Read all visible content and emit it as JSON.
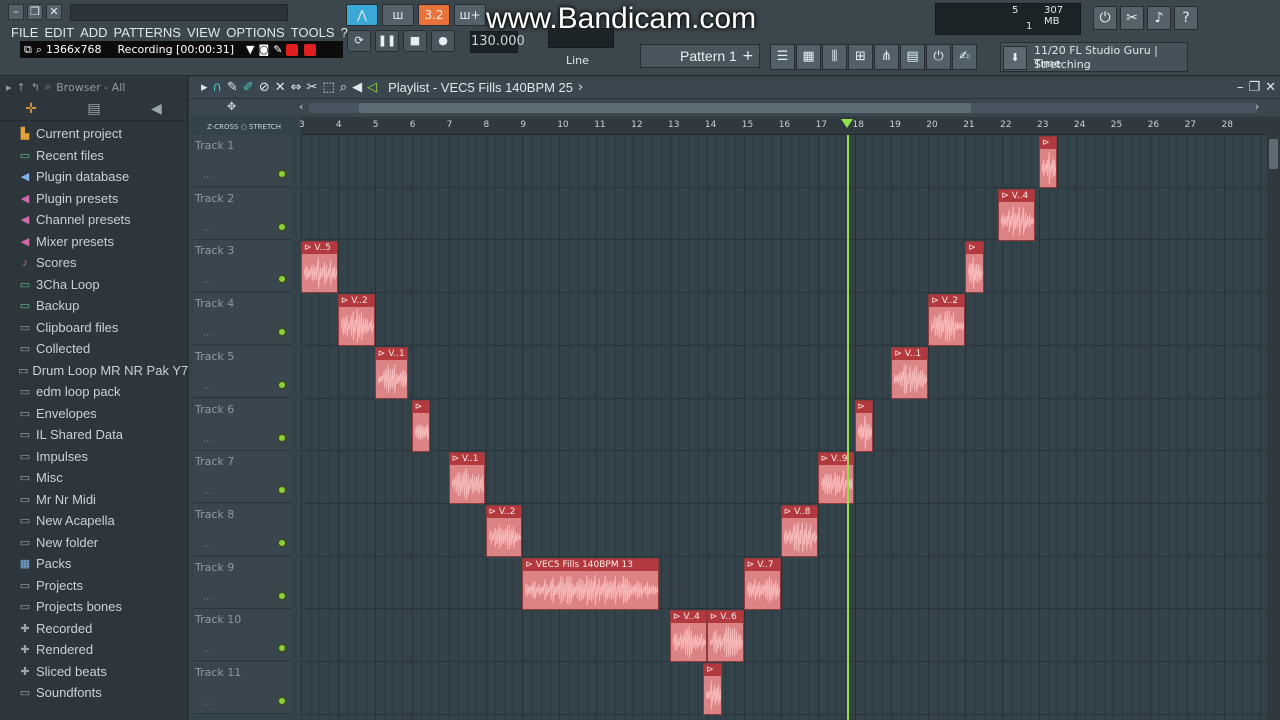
{
  "topbar": {
    "menu": [
      "FILE",
      "EDIT",
      "ADD",
      "PATTERNS",
      "VIEW",
      "OPTIONS",
      "TOOLS",
      "?"
    ],
    "recorder": {
      "resolution": "1366x768",
      "status": "Recording [00:00:31]"
    },
    "watermark": "www.Bandicam.com",
    "tempo": "130.000",
    "snap": "Line",
    "pattern": "Pattern 1",
    "memory": {
      "value_a": "5",
      "value_b": "307 MB",
      "value_c": "1"
    },
    "hint": {
      "line1": "11/20  FL Studio Guru | Time",
      "line2": "Stretching"
    }
  },
  "browser": {
    "header": "Browser - All",
    "items": [
      {
        "label": "Current project",
        "icon": "project-icon",
        "color": "#e2a43a"
      },
      {
        "label": "Recent files",
        "icon": "folder-icon",
        "color": "#5fc08a"
      },
      {
        "label": "Plugin database",
        "icon": "plugin-icon",
        "color": "#7fb0e6"
      },
      {
        "label": "Plugin presets",
        "icon": "preset-icon",
        "color": "#d16ba8"
      },
      {
        "label": "Channel presets",
        "icon": "preset-icon",
        "color": "#d16ba8"
      },
      {
        "label": "Mixer presets",
        "icon": "preset-icon",
        "color": "#d16ba8"
      },
      {
        "label": "Scores",
        "icon": "note-icon",
        "color": "#d16ba8"
      },
      {
        "label": "3Cha Loop",
        "icon": "folder-icon",
        "color": "#5fc08a"
      },
      {
        "label": "Backup",
        "icon": "folder-icon",
        "color": "#5fc08a"
      },
      {
        "label": "Clipboard files",
        "icon": "folder-icon",
        "color": "#9aa6ad"
      },
      {
        "label": "Collected",
        "icon": "folder-icon",
        "color": "#9aa6ad"
      },
      {
        "label": "Drum Loop MR NR Pak Y7",
        "icon": "folder-icon",
        "color": "#9aa6ad"
      },
      {
        "label": "edm loop pack",
        "icon": "folder-icon",
        "color": "#9aa6ad"
      },
      {
        "label": "Envelopes",
        "icon": "folder-icon",
        "color": "#9aa6ad"
      },
      {
        "label": "IL Shared Data",
        "icon": "folder-icon",
        "color": "#9aa6ad"
      },
      {
        "label": "Impulses",
        "icon": "folder-icon",
        "color": "#9aa6ad"
      },
      {
        "label": "Misc",
        "icon": "folder-icon",
        "color": "#9aa6ad"
      },
      {
        "label": "Mr Nr Midi",
        "icon": "folder-icon",
        "color": "#9aa6ad"
      },
      {
        "label": "New Acapella",
        "icon": "folder-icon",
        "color": "#9aa6ad"
      },
      {
        "label": "New folder",
        "icon": "folder-icon",
        "color": "#9aa6ad"
      },
      {
        "label": "Packs",
        "icon": "pack-icon",
        "color": "#7fb0e6"
      },
      {
        "label": "Projects",
        "icon": "folder-icon",
        "color": "#9aa6ad"
      },
      {
        "label": "Projects bones",
        "icon": "folder-icon",
        "color": "#9aa6ad"
      },
      {
        "label": "Recorded",
        "icon": "plus-icon",
        "color": "#9aa6ad"
      },
      {
        "label": "Rendered",
        "icon": "plus-icon",
        "color": "#9aa6ad"
      },
      {
        "label": "Sliced beats",
        "icon": "plus-icon",
        "color": "#9aa6ad"
      },
      {
        "label": "Soundfonts",
        "icon": "folder-icon",
        "color": "#9aa6ad"
      }
    ]
  },
  "playlist": {
    "title": "Playlist - VEC5 Fills 140BPM 25",
    "zcross": "Z-CROSS",
    "stretch": "STRETCH",
    "ruler_labels": [
      "3",
      "4",
      "5",
      "6",
      "7",
      "8",
      "9",
      "10",
      "11",
      "12",
      "13",
      "14",
      "15",
      "16",
      "17",
      "18",
      "19",
      "20",
      "21",
      "22",
      "23",
      "24",
      "25",
      "26",
      "27",
      "28"
    ],
    "tracks": [
      "Track 1",
      "Track 2",
      "Track 3",
      "Track 4",
      "Track 5",
      "Track 6",
      "Track 7",
      "Track 8",
      "Track 9",
      "Track 10",
      "Track 11"
    ],
    "playhead_bar": 17.8,
    "clips": [
      {
        "track": 0,
        "start": 23.0,
        "len": 0.5,
        "label": ""
      },
      {
        "track": 1,
        "start": 21.9,
        "len": 1.0,
        "label": "V..4"
      },
      {
        "track": 2,
        "start": 3.0,
        "len": 1.0,
        "label": "V..5"
      },
      {
        "track": 2,
        "start": 21.0,
        "len": 0.5,
        "label": ""
      },
      {
        "track": 3,
        "start": 4.0,
        "len": 1.0,
        "label": "V..2"
      },
      {
        "track": 3,
        "start": 20.0,
        "len": 1.0,
        "label": "V..2"
      },
      {
        "track": 4,
        "start": 5.0,
        "len": 0.9,
        "label": "V..1"
      },
      {
        "track": 4,
        "start": 19.0,
        "len": 1.0,
        "label": "V..1"
      },
      {
        "track": 5,
        "start": 6.0,
        "len": 0.5,
        "label": ""
      },
      {
        "track": 5,
        "start": 18.0,
        "len": 0.5,
        "label": ""
      },
      {
        "track": 6,
        "start": 7.0,
        "len": 1.0,
        "label": "V..1"
      },
      {
        "track": 6,
        "start": 17.0,
        "len": 1.0,
        "label": "V..9"
      },
      {
        "track": 7,
        "start": 8.0,
        "len": 1.0,
        "label": "V..2"
      },
      {
        "track": 7,
        "start": 16.0,
        "len": 1.0,
        "label": "V..8"
      },
      {
        "track": 8,
        "start": 9.0,
        "len": 3.7,
        "label": "VEC5 Fills 140BPM 13"
      },
      {
        "track": 8,
        "start": 15.0,
        "len": 1.0,
        "label": "V..7"
      },
      {
        "track": 9,
        "start": 13.0,
        "len": 1.0,
        "label": "V..4"
      },
      {
        "track": 9,
        "start": 14.0,
        "len": 1.0,
        "label": "V..6"
      },
      {
        "track": 10,
        "start": 13.9,
        "len": 0.5,
        "label": ""
      }
    ]
  },
  "colors": {
    "clip_body": "#dc8385",
    "clip_header": "#b23a3e",
    "playhead": "#8fe04a",
    "accent": "#3aa9d8"
  }
}
